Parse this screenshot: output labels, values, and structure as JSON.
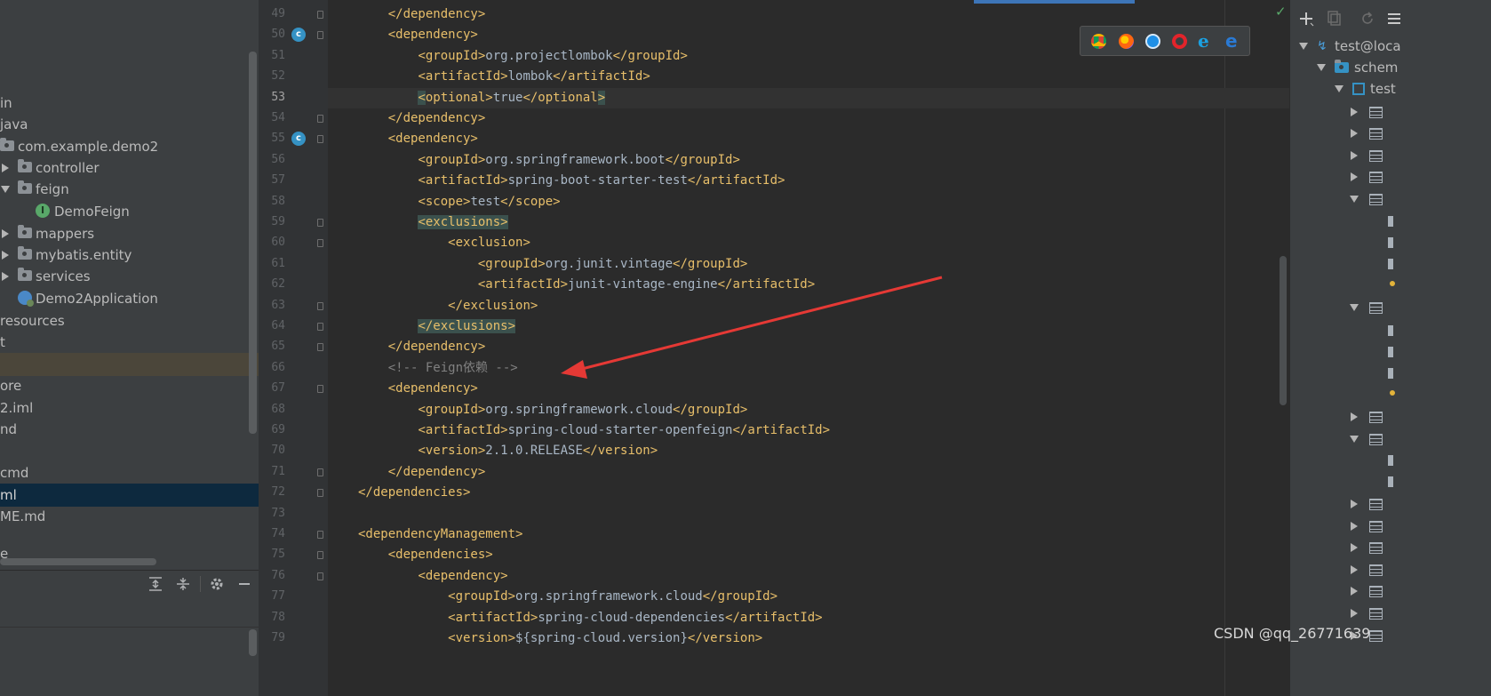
{
  "project_tree": {
    "items": [
      {
        "label": "in"
      },
      {
        "label": "java"
      },
      {
        "label": "com.example.demo2"
      },
      {
        "label": "controller"
      },
      {
        "label": "feign"
      },
      {
        "label": "DemoFeign",
        "badge": "I"
      },
      {
        "label": "mappers"
      },
      {
        "label": "mybatis.entity"
      },
      {
        "label": "services"
      },
      {
        "label": "Demo2Application"
      },
      {
        "label": "resources"
      },
      {
        "label": "t"
      },
      {
        "label": ""
      },
      {
        "label": "ore"
      },
      {
        "label": "2.iml"
      },
      {
        "label": "nd"
      },
      {
        "label": ""
      },
      {
        "label": "cmd"
      },
      {
        "label": "ml"
      },
      {
        "label": "ME.md"
      },
      {
        "label": "e"
      }
    ]
  },
  "editor": {
    "lines": [
      {
        "n": "49",
        "html": "    <span class='tag'>&lt;/dependency&gt;</span>"
      },
      {
        "n": "50",
        "html": "    <span class='tag'>&lt;dependency&gt;</span>"
      },
      {
        "n": "51",
        "html": "        <span class='tag'>&lt;groupId&gt;</span>org.projectlombok<span class='tag'>&lt;/groupId&gt;</span>"
      },
      {
        "n": "52",
        "html": "        <span class='tag'>&lt;artifactId&gt;</span>lombok<span class='tag'>&lt;/artifactId&gt;</span>"
      },
      {
        "n": "53",
        "html": "        <span class='tag'><span class='mt'>&lt;</span>optional&gt;</span>true<span class='tag'>&lt;/optional<span class='mt'>&gt;</span></span>"
      },
      {
        "n": "54",
        "html": "    <span class='tag'>&lt;/dependency&gt;</span>"
      },
      {
        "n": "55",
        "html": "    <span class='tag'>&lt;dependency&gt;</span>"
      },
      {
        "n": "56",
        "html": "        <span class='tag'>&lt;groupId&gt;</span>org.springframework.boot<span class='tag'>&lt;/groupId&gt;</span>"
      },
      {
        "n": "57",
        "html": "        <span class='tag'>&lt;artifactId&gt;</span>spring-boot-starter-test<span class='tag'>&lt;/artifactId&gt;</span>"
      },
      {
        "n": "58",
        "html": "        <span class='tag'>&lt;scope&gt;</span>test<span class='tag'>&lt;/scope&gt;</span>"
      },
      {
        "n": "59",
        "html": "        <span class='tag mt'>&lt;exclusions&gt;</span>"
      },
      {
        "n": "60",
        "html": "            <span class='tag'>&lt;exclusion&gt;</span>"
      },
      {
        "n": "61",
        "html": "                <span class='tag'>&lt;groupId&gt;</span>org.junit.vintage<span class='tag'>&lt;/groupId&gt;</span>"
      },
      {
        "n": "62",
        "html": "                <span class='tag'>&lt;artifactId&gt;</span>junit-vintage-engine<span class='tag'>&lt;/artifactId&gt;</span>"
      },
      {
        "n": "63",
        "html": "            <span class='tag'>&lt;/exclusion&gt;</span>"
      },
      {
        "n": "64",
        "html": "        <span class='tag mt'>&lt;/exclusions&gt;</span>"
      },
      {
        "n": "65",
        "html": "    <span class='tag'>&lt;/dependency&gt;</span>"
      },
      {
        "n": "66",
        "html": "    <span class='cmt'>&lt;!-- Feign依赖 --&gt;</span>"
      },
      {
        "n": "67",
        "html": "    <span class='tag'>&lt;dependency&gt;</span>"
      },
      {
        "n": "68",
        "html": "        <span class='tag'>&lt;groupId&gt;</span>org.springframework.cloud<span class='tag'>&lt;/groupId&gt;</span>"
      },
      {
        "n": "69",
        "html": "        <span class='tag'>&lt;artifactId&gt;</span>spring-cloud-starter-openfeign<span class='tag'>&lt;/artifactId&gt;</span>"
      },
      {
        "n": "70",
        "html": "        <span class='tag'>&lt;version&gt;</span>2.1.0.RELEASE<span class='tag'>&lt;/version&gt;</span>"
      },
      {
        "n": "71",
        "html": "    <span class='tag'>&lt;/dependency&gt;</span>"
      },
      {
        "n": "72",
        "html": "<span class='tag'>&lt;/dependencies&gt;</span>"
      },
      {
        "n": "73",
        "html": ""
      },
      {
        "n": "74",
        "html": "<span class='tag'>&lt;dependencyManagement&gt;</span>"
      },
      {
        "n": "75",
        "html": "    <span class='tag'>&lt;dependencies&gt;</span>"
      },
      {
        "n": "76",
        "html": "        <span class='tag'>&lt;dependency&gt;</span>"
      },
      {
        "n": "77",
        "html": "            <span class='tag'>&lt;groupId&gt;</span>org.springframework.cloud<span class='tag'>&lt;/groupId&gt;</span>"
      },
      {
        "n": "78",
        "html": "            <span class='tag'>&lt;artifactId&gt;</span>spring-cloud-dependencies<span class='tag'>&lt;/artifactId&gt;</span>"
      },
      {
        "n": "79",
        "html": "            <span class='tag'>&lt;version&gt;</span>${spring-cloud.version}<span class='tag'>&lt;/version&gt;</span>"
      }
    ],
    "current_line": "53"
  },
  "browser_icons": [
    "chrome-icon",
    "firefox-icon",
    "safari-icon",
    "opera-icon",
    "ie-icon",
    "edge-icon"
  ],
  "database_panel": {
    "items": [
      {
        "label": "test@loca"
      },
      {
        "label": "schem"
      },
      {
        "label": "test"
      }
    ]
  },
  "watermark": "CSDN @qq_26771639",
  "colors": {
    "tag": "#e8bf6a",
    "text": "#a9b7c6",
    "comment": "#808080",
    "editor_bg": "#2b2b2b",
    "panel_bg": "#3c3f41",
    "arrow": "#e53935"
  }
}
